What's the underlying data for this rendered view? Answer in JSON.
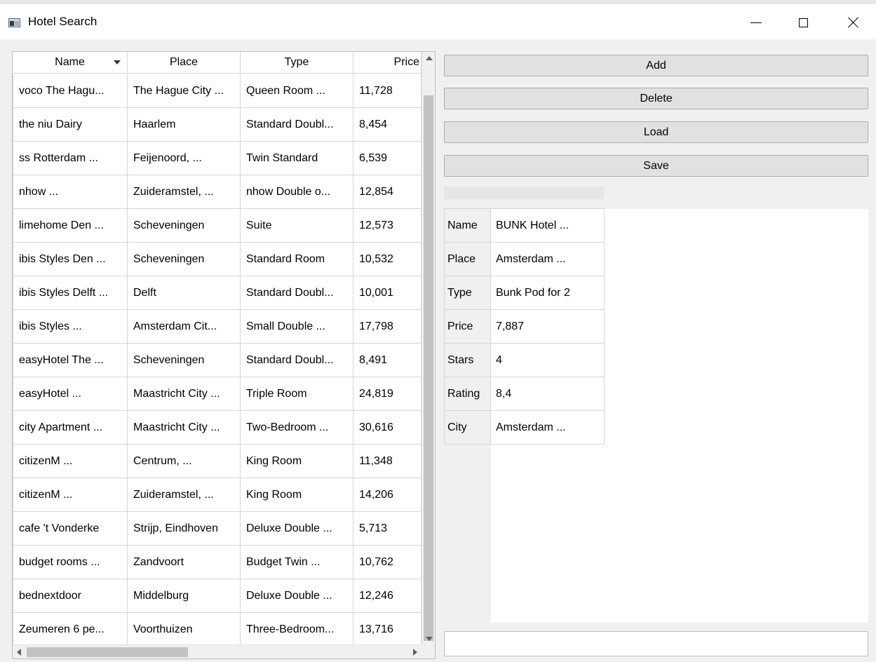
{
  "window": {
    "title": "Hotel Search"
  },
  "table": {
    "columns": [
      "Name",
      "Place",
      "Type",
      "Price"
    ],
    "rows": [
      [
        "voco The Hagu...",
        "The Hague City ...",
        "Queen Room ...",
        "11,728"
      ],
      [
        "the niu Dairy",
        "Haarlem",
        "Standard Doubl...",
        "8,454"
      ],
      [
        "ss Rotterdam ...",
        "Feijenoord, ...",
        "Twin Standard",
        "6,539"
      ],
      [
        "nhow ...",
        "Zuideramstel, ...",
        "nhow Double o...",
        "12,854"
      ],
      [
        "limehome Den ...",
        "Scheveningen",
        "Suite",
        "12,573"
      ],
      [
        "ibis Styles Den ...",
        "Scheveningen",
        "Standard Room",
        "10,532"
      ],
      [
        "ibis Styles Delft ...",
        "Delft",
        "Standard Doubl...",
        "10,001"
      ],
      [
        "ibis Styles ...",
        "Amsterdam Cit...",
        "Small Double ...",
        "17,798"
      ],
      [
        "easyHotel The ...",
        "Scheveningen",
        "Standard Doubl...",
        "8,491"
      ],
      [
        "easyHotel ...",
        "Maastricht City ...",
        "Triple Room",
        "24,819"
      ],
      [
        "city Apartment ...",
        "Maastricht City ...",
        "Two-Bedroom ...",
        "30,616"
      ],
      [
        "citizenM ...",
        "Centrum, ...",
        "King Room",
        "11,348"
      ],
      [
        "citizenM ...",
        "Zuideramstel, ...",
        "King Room",
        "14,206"
      ],
      [
        "cafe 't Vonderke",
        "Strijp, Eindhoven",
        "Deluxe Double ...",
        "5,713"
      ],
      [
        "budget rooms ...",
        "Zandvoort",
        "Budget Twin ...",
        "10,762"
      ],
      [
        "bednextdoor",
        "Middelburg",
        "Deluxe Double ...",
        "12,246"
      ],
      [
        "Zeumeren 6 pe...",
        "Voorthuizen",
        "Three-Bedroom...",
        "13,716"
      ]
    ]
  },
  "buttons": {
    "add": "Add",
    "delete": "Delete",
    "load": "Load",
    "save": "Save"
  },
  "detail": [
    {
      "key": "Name",
      "value": "BUNK Hotel ..."
    },
    {
      "key": "Place",
      "value": "Amsterdam ..."
    },
    {
      "key": "Type",
      "value": "Bunk Pod for 2"
    },
    {
      "key": "Price",
      "value": "7,887"
    },
    {
      "key": "Stars",
      "value": "4"
    },
    {
      "key": "Rating",
      "value": "8,4"
    },
    {
      "key": "City",
      "value": "Amsterdam ..."
    }
  ],
  "status_input": {
    "value": ""
  },
  "icons": {
    "sort": "sort-descending-icon",
    "scroll_up": "arrow-up-icon",
    "scroll_down": "arrow-down-icon",
    "scroll_left": "arrow-left-icon",
    "scroll_right": "arrow-right-icon"
  }
}
